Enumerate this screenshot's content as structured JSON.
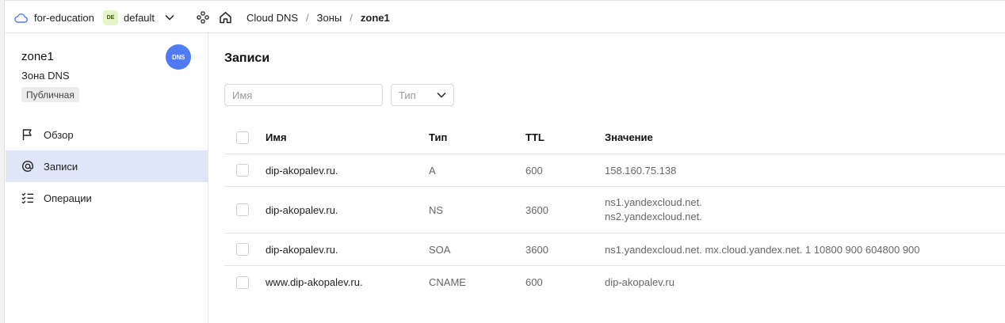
{
  "header": {
    "cloud_name": "for-education",
    "folder_badge": "DE",
    "folder_name": "default",
    "breadcrumbs": [
      "Cloud DNS",
      "Зоны",
      "zone1"
    ],
    "separator": "/"
  },
  "sidebar": {
    "zone_name": "zone1",
    "zone_type": "Зона DNS",
    "zone_visibility": "Публичная",
    "avatar_text": "DNS",
    "items": [
      {
        "label": "Обзор",
        "icon": "flag-icon",
        "active": false
      },
      {
        "label": "Записи",
        "icon": "at-sign-icon",
        "active": true
      },
      {
        "label": "Операции",
        "icon": "checklist-icon",
        "active": false
      }
    ]
  },
  "main": {
    "title": "Записи",
    "filter_name_placeholder": "Имя",
    "filter_type_placeholder": "Тип",
    "columns": [
      "Имя",
      "Тип",
      "TTL",
      "Значение"
    ],
    "rows": [
      {
        "name": "dip-akopalev.ru.",
        "type": "A",
        "ttl": "600",
        "values": [
          "158.160.75.138"
        ]
      },
      {
        "name": "dip-akopalev.ru.",
        "type": "NS",
        "ttl": "3600",
        "values": [
          "ns1.yandexcloud.net.",
          "ns2.yandexcloud.net."
        ]
      },
      {
        "name": "dip-akopalev.ru.",
        "type": "SOA",
        "ttl": "3600",
        "values": [
          "ns1.yandexcloud.net. mx.cloud.yandex.net. 1 10800 900 604800 900"
        ]
      },
      {
        "name": "www.dip-akopalev.ru.",
        "type": "CNAME",
        "ttl": "600",
        "values": [
          "dip-akopalev.ru"
        ]
      }
    ]
  },
  "colors": {
    "accent": "#4f7cf5",
    "active_nav_bg": "#dfe6f8",
    "badge_bg": "#e6f5c7"
  }
}
